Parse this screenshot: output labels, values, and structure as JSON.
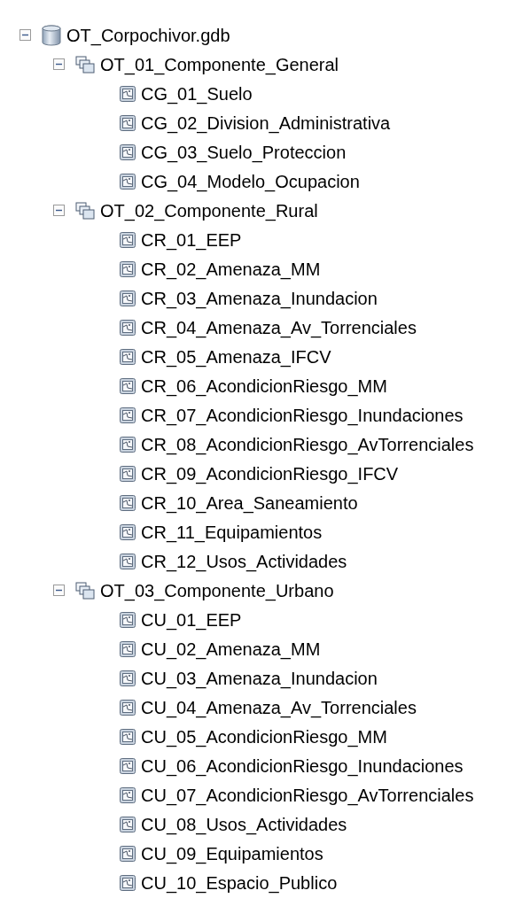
{
  "tree": {
    "label": "OT_Corpochivor.gdb",
    "kind": "geodatabase",
    "expanded": true,
    "children": [
      {
        "label": "OT_01_Componente_General",
        "kind": "dataset",
        "expanded": true,
        "children": [
          {
            "label": "CG_01_Suelo",
            "kind": "featureclass"
          },
          {
            "label": "CG_02_Division_Administrativa",
            "kind": "featureclass"
          },
          {
            "label": "CG_03_Suelo_Proteccion",
            "kind": "featureclass"
          },
          {
            "label": "CG_04_Modelo_Ocupacion",
            "kind": "featureclass"
          }
        ]
      },
      {
        "label": "OT_02_Componente_Rural",
        "kind": "dataset",
        "expanded": true,
        "children": [
          {
            "label": "CR_01_EEP",
            "kind": "featureclass"
          },
          {
            "label": "CR_02_Amenaza_MM",
            "kind": "featureclass"
          },
          {
            "label": "CR_03_Amenaza_Inundacion",
            "kind": "featureclass"
          },
          {
            "label": "CR_04_Amenaza_Av_Torrenciales",
            "kind": "featureclass"
          },
          {
            "label": "CR_05_Amenaza_IFCV",
            "kind": "featureclass"
          },
          {
            "label": "CR_06_AcondicionRiesgo_MM",
            "kind": "featureclass"
          },
          {
            "label": "CR_07_AcondicionRiesgo_Inundaciones",
            "kind": "featureclass"
          },
          {
            "label": "CR_08_AcondicionRiesgo_AvTorrenciales",
            "kind": "featureclass"
          },
          {
            "label": "CR_09_AcondicionRiesgo_IFCV",
            "kind": "featureclass"
          },
          {
            "label": "CR_10_Area_Saneamiento",
            "kind": "featureclass"
          },
          {
            "label": "CR_11_Equipamientos",
            "kind": "featureclass"
          },
          {
            "label": "CR_12_Usos_Actividades",
            "kind": "featureclass"
          }
        ]
      },
      {
        "label": "OT_03_Componente_Urbano",
        "kind": "dataset",
        "expanded": true,
        "children": [
          {
            "label": "CU_01_EEP",
            "kind": "featureclass"
          },
          {
            "label": "CU_02_Amenaza_MM",
            "kind": "featureclass"
          },
          {
            "label": "CU_03_Amenaza_Inundacion",
            "kind": "featureclass"
          },
          {
            "label": "CU_04_Amenaza_Av_Torrenciales",
            "kind": "featureclass"
          },
          {
            "label": "CU_05_AcondicionRiesgo_MM",
            "kind": "featureclass"
          },
          {
            "label": "CU_06_AcondicionRiesgo_Inundaciones",
            "kind": "featureclass"
          },
          {
            "label": "CU_07_AcondicionRiesgo_AvTorrenciales",
            "kind": "featureclass"
          },
          {
            "label": "CU_08_Usos_Actividades",
            "kind": "featureclass"
          },
          {
            "label": "CU_09_Equipamientos",
            "kind": "featureclass"
          },
          {
            "label": "CU_10_Espacio_Publico",
            "kind": "featureclass"
          }
        ]
      }
    ]
  }
}
